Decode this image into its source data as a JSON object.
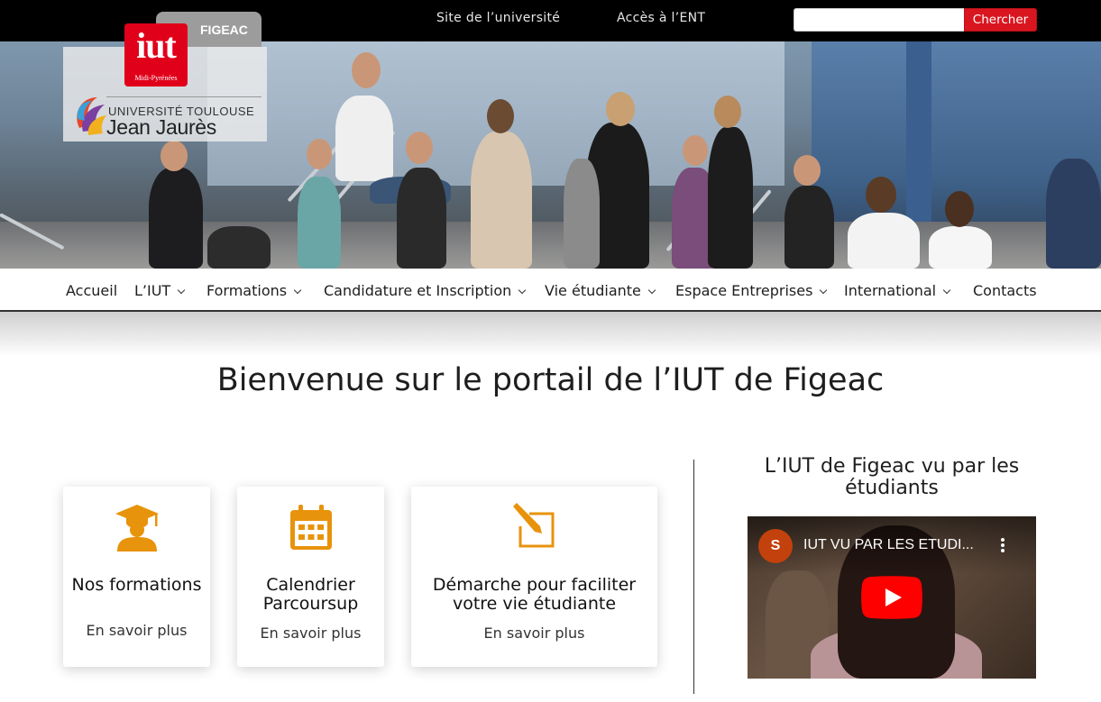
{
  "topbar": {
    "link_university": "Site de l’université",
    "link_ent": "Accès à l’ENT",
    "search_placeholder": "",
    "search_button": "Chercher"
  },
  "logo": {
    "campus_tab": "FIGEAC",
    "iut_mark": "iut",
    "iut_region": "Midi-Pyrénées",
    "university_line1": "UNIVERSITÉ TOULOUSE",
    "university_line2": "Jean Jaurès"
  },
  "nav": {
    "items": [
      {
        "label": "Accueil",
        "dropdown": false
      },
      {
        "label": "L’IUT",
        "dropdown": true
      },
      {
        "label": "Formations",
        "dropdown": true
      },
      {
        "label": "Candidature et Inscription",
        "dropdown": true
      },
      {
        "label": "Vie étudiante",
        "dropdown": true
      },
      {
        "label": "Espace Entreprises",
        "dropdown": true
      },
      {
        "label": "International",
        "dropdown": true
      },
      {
        "label": "Contacts",
        "dropdown": false
      }
    ]
  },
  "main": {
    "welcome": "Bienvenue sur le portail de l’IUT de Figeac",
    "cards": [
      {
        "icon": "graduate-icon",
        "title": "Nos formations",
        "link": "En savoir plus"
      },
      {
        "icon": "calendar-icon",
        "title": "Calendrier Parcoursup",
        "link": "En savoir plus"
      },
      {
        "icon": "edit-icon",
        "title": "Démarche pour faciliter votre vie étudiante",
        "link": "En savoir plus"
      }
    ]
  },
  "sidebar": {
    "title": "L’IUT de Figeac vu par les étudiants",
    "video": {
      "channel_initial": "S",
      "title": "IUT VU PAR LES ETUDI..."
    }
  },
  "colors": {
    "accent_orange": "#e8930c",
    "search_red": "#d9161f",
    "iut_red": "#e1001a",
    "youtube_red": "#ff0000"
  }
}
